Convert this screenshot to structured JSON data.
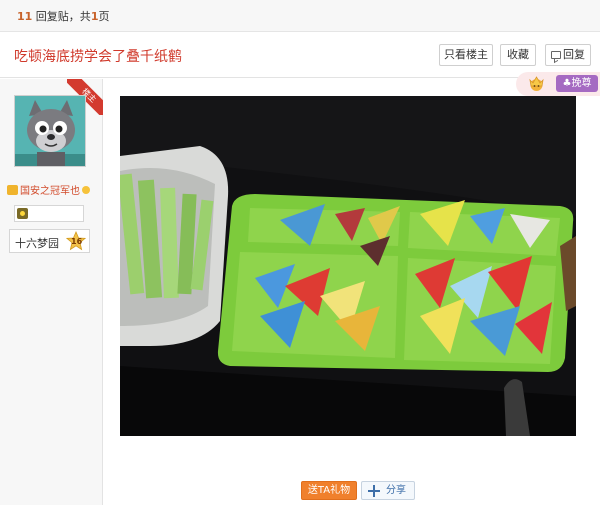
{
  "topbar": {
    "reply_count": "11",
    "reply_suffix": " 回复贴，共",
    "page_count": "1",
    "page_suffix": "页"
  },
  "thread": {
    "title": "吃顿海底捞学会了叠千纸鹤"
  },
  "actions": {
    "author_only": "只看楼主",
    "favorite": "收藏",
    "reply": "回复"
  },
  "author": {
    "ribbon": "楼主",
    "username": "国安之冠军也",
    "level_name": "十六梦园",
    "level_num": "16"
  },
  "tip": {
    "label": "挽尊"
  },
  "footer": {
    "gift": "送TA礼物",
    "share": "分享"
  },
  "colors": {
    "title_red": "#d03a2c",
    "gift_orange": "#f0802c",
    "tip_purple": "#a56ac2",
    "tray_green": "#7dcb3c"
  }
}
